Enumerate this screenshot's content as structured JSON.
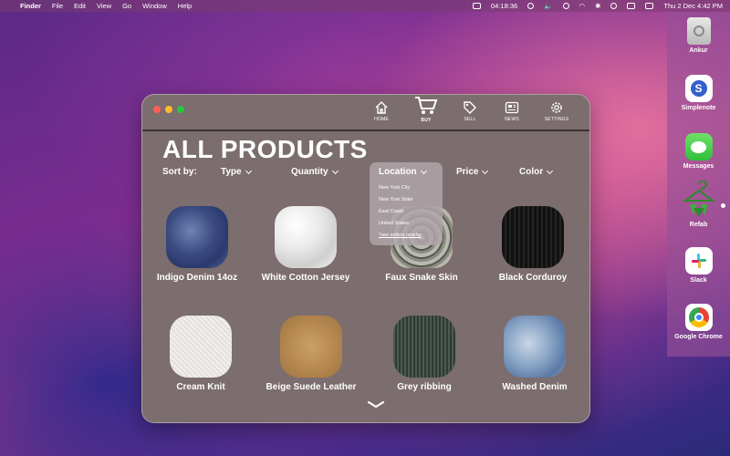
{
  "menubar": {
    "apple_glyph": "",
    "app_name": "Finder",
    "menus": [
      "File",
      "Edit",
      "View",
      "Go",
      "Window",
      "Help"
    ],
    "timer": "04:18:36",
    "datetime": "Thu 2 Dec  4:42 PM"
  },
  "dock": {
    "items": [
      {
        "label": "Ankur",
        "icon": "hard-drive-icon"
      },
      {
        "label": "Simplenote",
        "icon": "simplenote-icon"
      },
      {
        "label": "Messages",
        "icon": "messages-icon"
      },
      {
        "label": "Refab",
        "icon": "refab-hanger-icon"
      },
      {
        "label": "Slack",
        "icon": "slack-icon"
      },
      {
        "label": "Google Chrome",
        "icon": "chrome-icon"
      }
    ]
  },
  "window": {
    "nav": [
      {
        "label": "HOME",
        "icon": "home-icon"
      },
      {
        "label": "BUY",
        "icon": "cart-icon"
      },
      {
        "label": "SELL",
        "icon": "tag-icon"
      },
      {
        "label": "NEWS",
        "icon": "news-icon"
      },
      {
        "label": "SETTINGS",
        "icon": "gear-icon"
      }
    ],
    "title": "ALL PRODUCTS",
    "sort_label": "Sort by:",
    "filters": [
      "Type",
      "Quantity",
      "Location",
      "Price",
      "Color"
    ],
    "location_dropdown": {
      "header": "Location",
      "options": [
        "New York City",
        "New York State",
        "East Coast",
        "United States"
      ],
      "more_link": "*see sellers nearby"
    },
    "products": [
      {
        "name": "Indigo Denim 14oz",
        "swatch": "indigo-denim"
      },
      {
        "name": "White Cotton Jersey",
        "swatch": "white-jersey"
      },
      {
        "name": "Faux Snake Skin",
        "swatch": "snake-skin"
      },
      {
        "name": "Black Corduroy",
        "swatch": "black-corduroy"
      },
      {
        "name": "Cream Knit",
        "swatch": "cream-knit"
      },
      {
        "name": "Beige Suede Leather",
        "swatch": "beige-suede"
      },
      {
        "name": "Grey ribbing",
        "swatch": "grey-ribbing"
      },
      {
        "name": "Washed Denim",
        "swatch": "washed-denim"
      }
    ]
  }
}
